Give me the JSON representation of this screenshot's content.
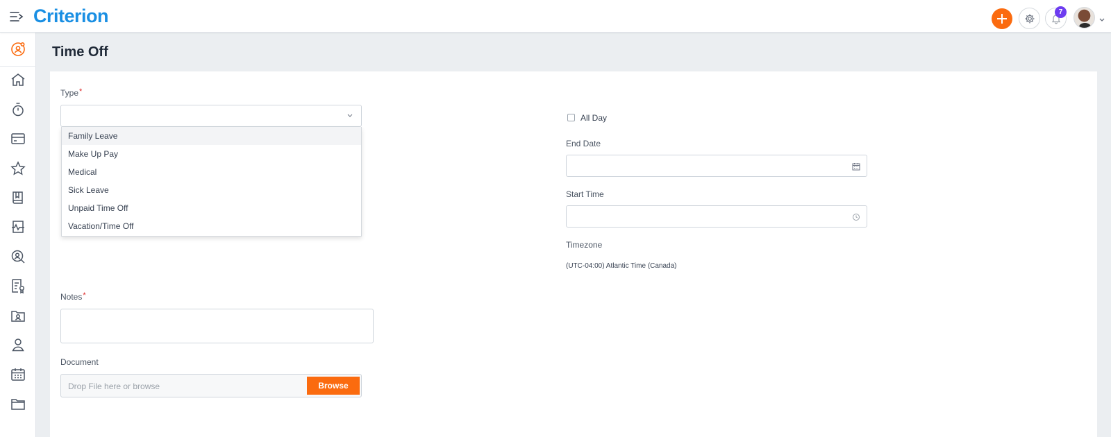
{
  "header": {
    "logo": "Criterion",
    "notifications_count": "7"
  },
  "page": {
    "title": "Time Off"
  },
  "form": {
    "type_label": "Type",
    "required_marker": "*",
    "type_value": "",
    "type_options": [
      "Family Leave",
      "Make Up Pay",
      "Medical",
      "Sick Leave",
      "Unpaid Time Off",
      "Vacation/Time Off"
    ],
    "highlighted_option": "Family Leave",
    "all_day_label": "All Day",
    "end_date_label": "End Date",
    "end_date_value": "",
    "start_time_label": "Start Time",
    "start_time_value": "",
    "timezone_label": "Timezone",
    "timezone_value": "(UTC-04:00) Atlantic Time (Canada)",
    "notes_label": "Notes",
    "notes_value": "",
    "document_label": "Document",
    "document_placeholder": "Drop File here or browse",
    "browse_label": "Browse"
  },
  "sidebar": {
    "icons": [
      "user-circle-icon",
      "home-icon",
      "stopwatch-icon",
      "card-icon",
      "star-icon",
      "book-icon",
      "pulse-icon",
      "search-user-icon",
      "document-badge-icon",
      "folder-user-icon",
      "person-icon",
      "calendar-icon",
      "folder-icon"
    ]
  },
  "colors": {
    "accent": "#fb6b0f",
    "brand": "#1a8fe3",
    "badge": "#6d3cf0",
    "required": "#dc2626"
  }
}
